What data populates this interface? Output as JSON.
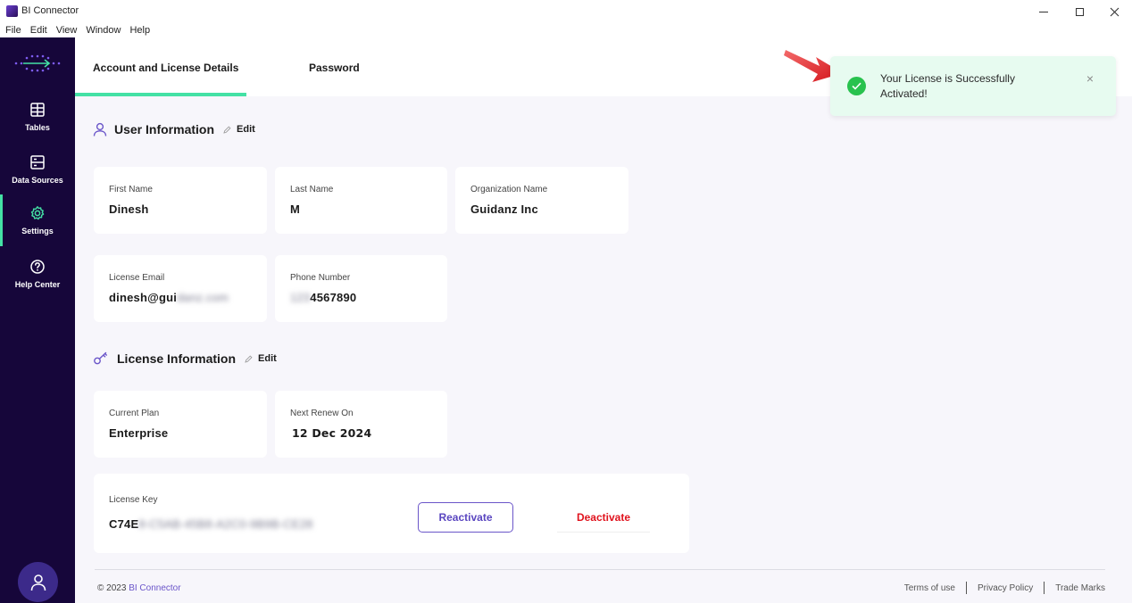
{
  "window": {
    "title": "BI Connector"
  },
  "menu": {
    "items": [
      "File",
      "Edit",
      "View",
      "Window",
      "Help"
    ]
  },
  "sidebar": {
    "items": [
      {
        "label": "Tables",
        "icon": "table-icon"
      },
      {
        "label": "Data Sources",
        "icon": "data-sources-icon"
      },
      {
        "label": "Settings",
        "icon": "settings-gear-icon",
        "active": true
      },
      {
        "label": "Help Center",
        "icon": "help-icon"
      }
    ],
    "active_color": "#44e1a5",
    "background": "#16063a"
  },
  "tabs": {
    "account": "Account and License Details",
    "password": "Password"
  },
  "user_info": {
    "title": "User Information",
    "edit": "Edit",
    "fields": {
      "first_name": {
        "label": "First Name",
        "value": "Dinesh"
      },
      "last_name": {
        "label": "Last Name",
        "value": "M"
      },
      "organization": {
        "label": "Organization Name",
        "value": "Guidanz Inc"
      },
      "license_email": {
        "label": "License Email",
        "value": "dinesh@gui",
        "value_blurred": "danz.com"
      },
      "phone": {
        "label": "Phone Number",
        "value": "4567890",
        "value_blurred": "123"
      }
    }
  },
  "license_info": {
    "title": "License Information",
    "edit": "Edit",
    "current_plan": {
      "label": "Current Plan",
      "value": "Enterprise"
    },
    "next_renew": {
      "label": "Next Renew On",
      "value": "12 Dec 2024"
    },
    "license_key": {
      "label": "License Key",
      "value": "C74E",
      "value_blurred": "8-C5AB-45B8-A2C0-9B9B-CE28"
    },
    "reactivate": "Reactivate",
    "deactivate": "Deactivate"
  },
  "footer": {
    "copyright": "© 2023",
    "brand": "BI Connector",
    "links": [
      "Terms of use",
      "Privacy Policy",
      "Trade Marks"
    ]
  },
  "toast": {
    "message": "Your License is Successfully Activated!",
    "icon": "check-circle-icon",
    "close": "×"
  },
  "colors": {
    "accent_green": "#44e1a5",
    "primary_purple": "#6a55c9",
    "danger_red": "#e0121d",
    "toast_bg": "#e7fbf0"
  }
}
